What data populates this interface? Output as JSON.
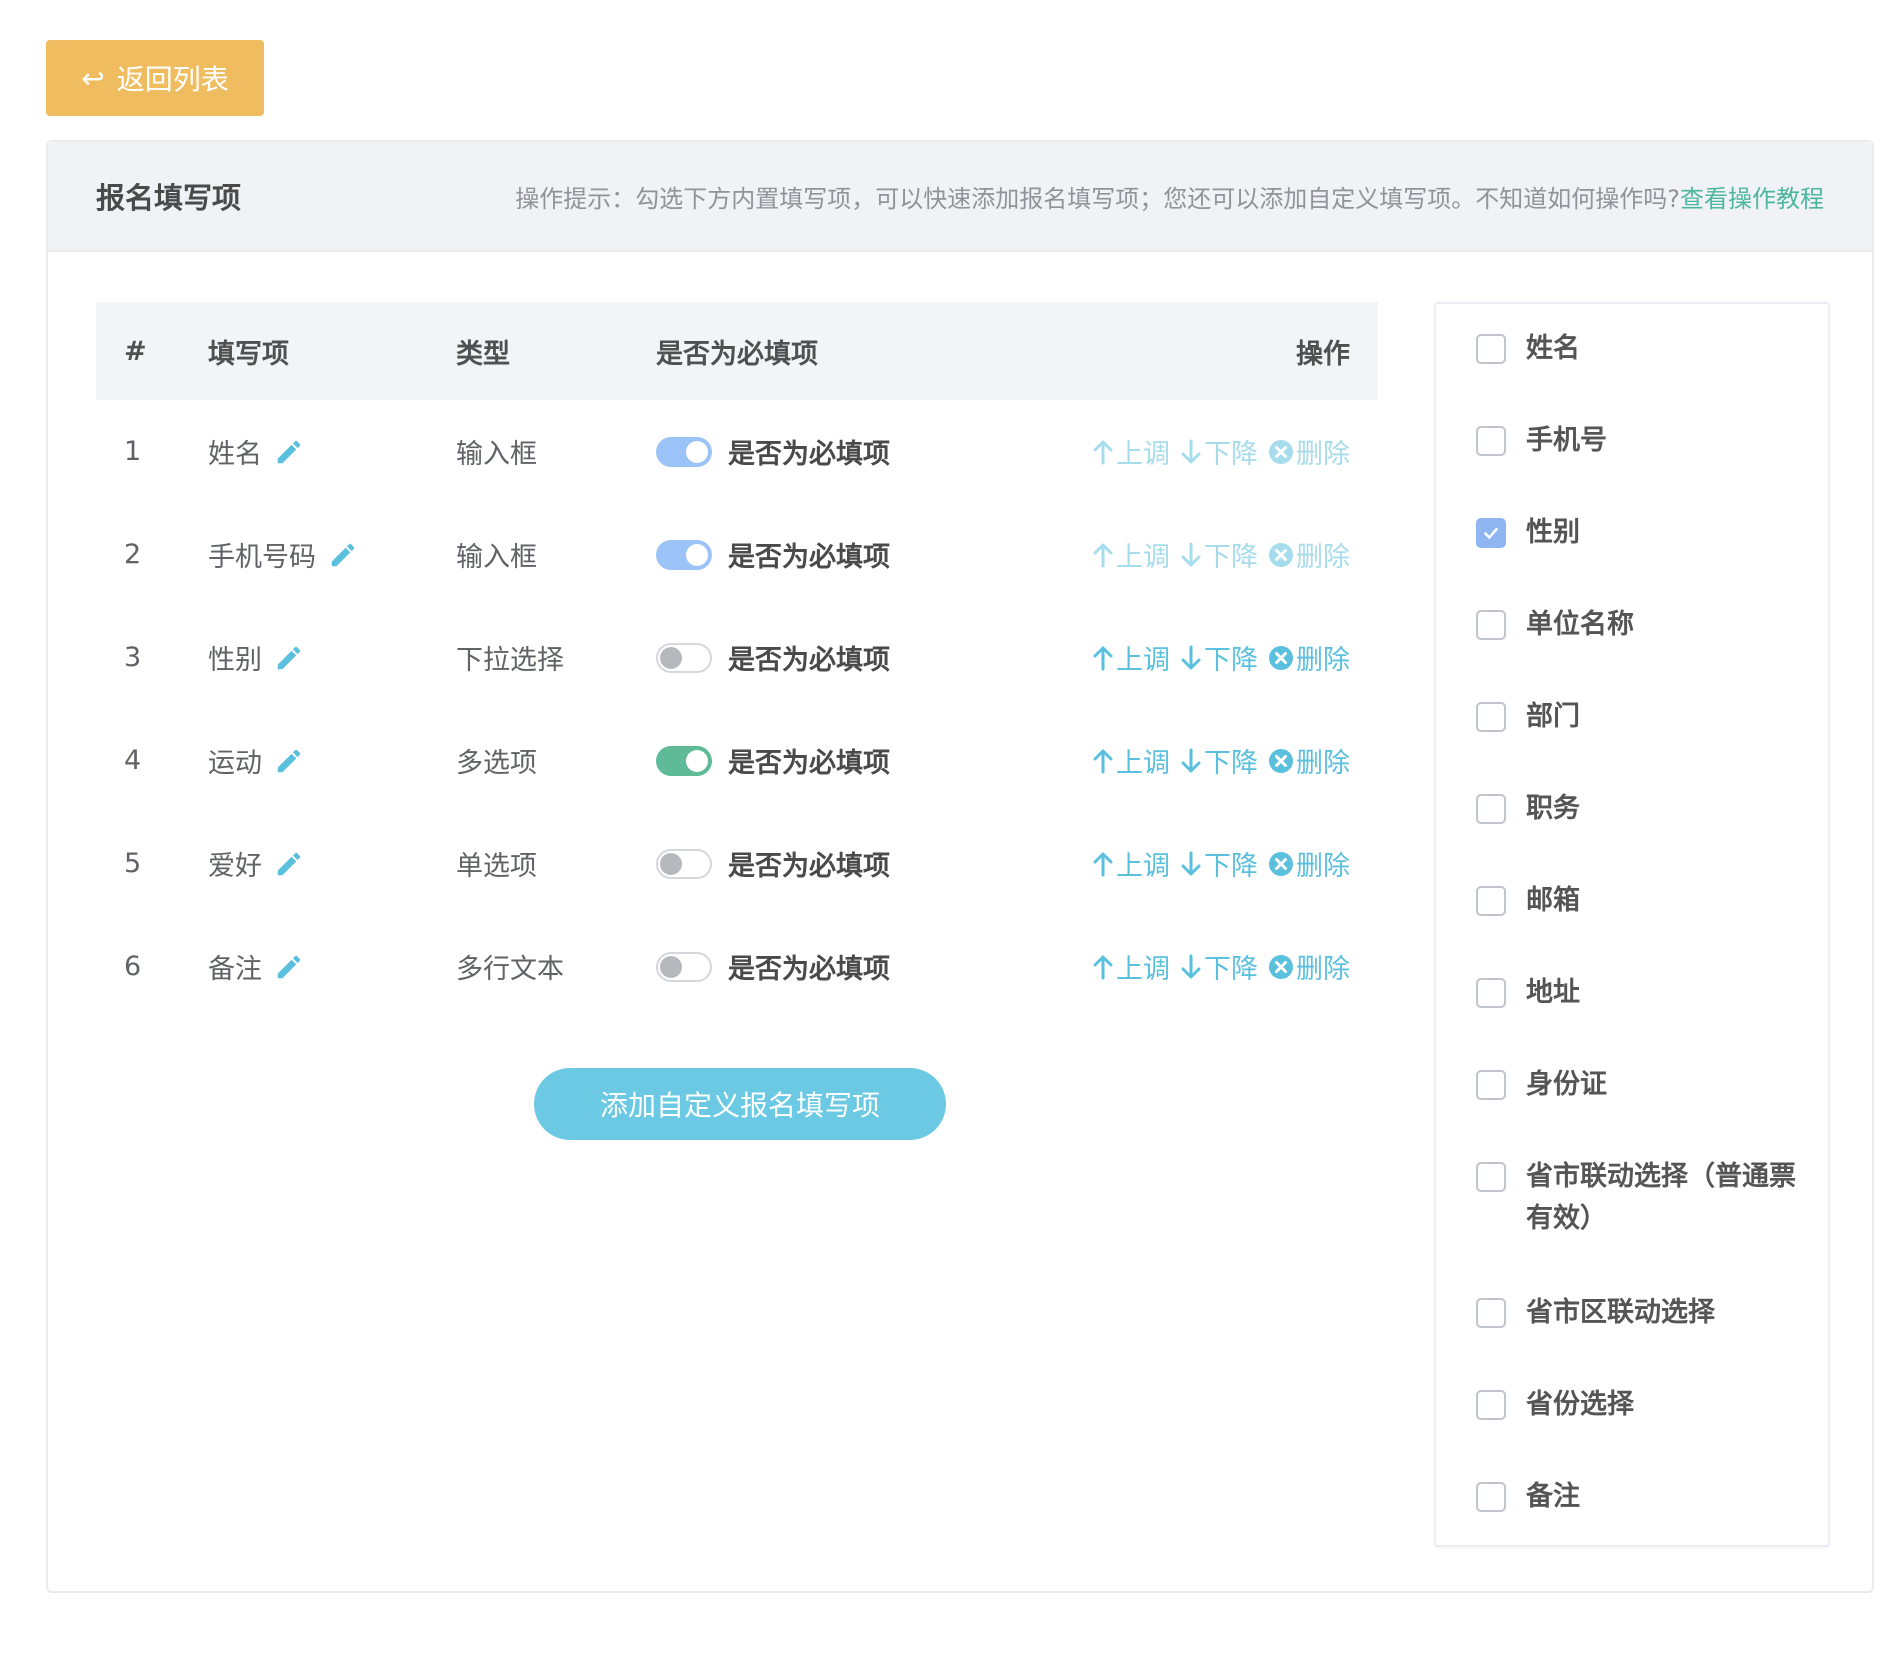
{
  "back_button": {
    "icon": "arrow-back-icon",
    "label": "返回列表"
  },
  "card": {
    "title": "报名填写项",
    "tip_text": "操作提示：勾选下方内置填写项，可以快速添加报名填写项；您还可以添加自定义填写项。不知道如何操作吗?",
    "tip_link": "查看操作教程"
  },
  "table": {
    "headers": {
      "index": "#",
      "field": "填写项",
      "type": "类型",
      "required": "是否为必填项",
      "actions": "操作"
    },
    "required_label": "是否为必填项",
    "actions": {
      "up": "上调",
      "down": "下降",
      "delete": "删除"
    },
    "rows": [
      {
        "index": "1",
        "field": "姓名",
        "type": "输入框",
        "required": "on",
        "actions_enabled": false
      },
      {
        "index": "2",
        "field": "手机号码",
        "type": "输入框",
        "required": "on",
        "actions_enabled": false
      },
      {
        "index": "3",
        "field": "性别",
        "type": "下拉选择",
        "required": "off",
        "actions_enabled": true
      },
      {
        "index": "4",
        "field": "运动",
        "type": "多选项",
        "required": "on-green",
        "actions_enabled": true
      },
      {
        "index": "5",
        "field": "爱好",
        "type": "单选项",
        "required": "off",
        "actions_enabled": true
      },
      {
        "index": "6",
        "field": "备注",
        "type": "多行文本",
        "required": "off",
        "actions_enabled": true
      }
    ]
  },
  "add_button": {
    "label": "添加自定义报名填写项"
  },
  "builtin_fields": [
    {
      "label": "姓名",
      "checked": false
    },
    {
      "label": "手机号",
      "checked": false
    },
    {
      "label": "性别",
      "checked": true
    },
    {
      "label": "单位名称",
      "checked": false
    },
    {
      "label": "部门",
      "checked": false
    },
    {
      "label": "职务",
      "checked": false
    },
    {
      "label": "邮箱",
      "checked": false
    },
    {
      "label": "地址",
      "checked": false
    },
    {
      "label": "身份证",
      "checked": false
    },
    {
      "label": "省市联动选择（普通票有效）",
      "checked": false
    },
    {
      "label": "省市区联动选择",
      "checked": false
    },
    {
      "label": "省份选择",
      "checked": false
    },
    {
      "label": "备注",
      "checked": false
    }
  ],
  "colors": {
    "back_button": "#efbd5f",
    "accent_link": "#4cb69f",
    "action_active": "#5bc0de",
    "action_faded": "#a6dcec",
    "switch_on": "#9cc3f7",
    "switch_on_green": "#5fba98",
    "checkbox_checked": "#8fb6f0",
    "add_button": "#6bc9e3"
  }
}
